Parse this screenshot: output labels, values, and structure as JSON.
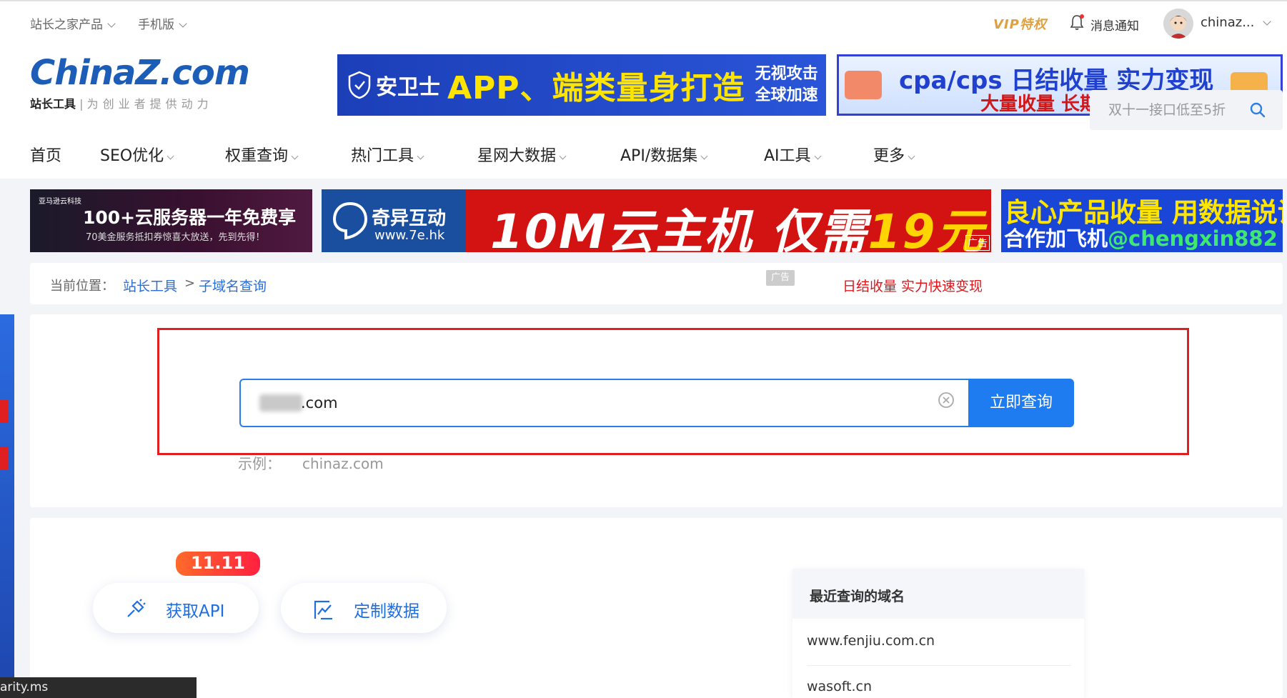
{
  "topbar": {
    "products": "站长之家产品",
    "mobile": "手机版",
    "vip": "VIP特权",
    "notifications": "消息通知",
    "username": "chinaz..."
  },
  "logo": {
    "main": "ChinaZ.com",
    "brand": "站长工具",
    "slogan": "为创业者提供动力"
  },
  "banners": {
    "b1_brand": "安卫士",
    "b1_main": "APP、端类量身打造",
    "b1_side1": "无视攻击",
    "b1_side2": "全球加速",
    "b2_line1": "cpa/cps 日结收量 实力变现",
    "b2_line2": "大量收量 长期稳定"
  },
  "nav": {
    "items": [
      "首页",
      "SEO优化",
      "权重查询",
      "热门工具",
      "星网大数据",
      "API/数据集",
      "AI工具",
      "更多"
    ],
    "search_placeholder": "双十一接口低至5折"
  },
  "ads": {
    "a1_brand": "亚马逊云科技",
    "a1_title": "100+云服务器一年免费享",
    "a1_sub": "70美金服务抵扣券惊喜大放送，先到先得！",
    "a2_company": "奇异互动",
    "a2_url": "www.7e.hk",
    "a2_main": "10M云主机 仅需",
    "a2_price": "19元",
    "a2_tag": "广告",
    "a3_line1": "良心产品收量 用数据说话",
    "a3_line2_prefix": "合作加飞机",
    "a3_line2_handle": "@chengxin882"
  },
  "breadcrumb": {
    "label": "当前位置：",
    "link1": "站长工具",
    "sep": ">",
    "link2": "子域名查询",
    "ad_badge": "广告",
    "promo": "日结收量 实力快速变现"
  },
  "query": {
    "value": ".com",
    "button": "立即查询",
    "example_label": "示例：",
    "example_value": "chinaz.com"
  },
  "lower": {
    "badge": "11.11",
    "api_button": "获取API",
    "custom_button": "定制数据",
    "recent_title": "最近查询的域名",
    "recent": [
      "www.fenjiu.com.cn",
      "wasoft.cn"
    ]
  },
  "status_bar": "arity.ms",
  "colors": {
    "accent": "#1f7cf0",
    "link": "#2a6ed8",
    "highlight_border": "#e02020"
  }
}
